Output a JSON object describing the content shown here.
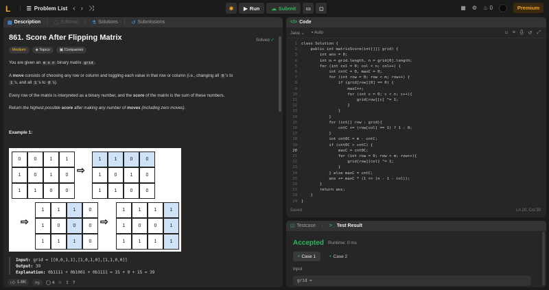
{
  "topbar": {
    "logo": "L",
    "problem_list": "Problem List",
    "run": "Run",
    "submit": "Submit",
    "streak_count": "0",
    "premium": "Premium"
  },
  "left_tabs": [
    {
      "label": "Description"
    },
    {
      "label": "Editorial"
    },
    {
      "label": "Solutions"
    },
    {
      "label": "Submissions"
    }
  ],
  "problem": {
    "title": "861. Score After Flipping Matrix",
    "solved": "Solved",
    "difficulty": "Medium",
    "topics": "Topics",
    "companies": "Companies",
    "p1_a": "You are given an ",
    "p1_code": "m x n",
    "p1_b": " binary matrix ",
    "p1_code2": "grid",
    "p1_c": ".",
    "p2_bold": "move",
    "p2_a": "A ",
    "p2_b": " consists of choosing any row or column and toggling each value in that row or column (i.e., changing all ",
    "p2_c0": "0",
    "p2_c": "'s to",
    "p2_c1": "1",
    "p2_d": "'s, and all ",
    "p2_c2": "1",
    "p2_e": "'s to ",
    "p2_c3": "0",
    "p2_f": "'s).",
    "p3_a": "Every row of the matrix is interpreted as a binary number, and the ",
    "p3_bold": "score",
    "p3_b": " of the matrix is the sum of these numbers.",
    "p4_a": "Return ",
    "p4_i1": "the highest possible ",
    "p4_bold": "score",
    "p4_i2": " after making any number of ",
    "p4_bold2": "moves",
    "p4_i3": " (including zero moves)",
    "p4_end": ".",
    "example_title": "Example 1:",
    "input_label": "Input:",
    "input_value": "grid = [[0,0,1,1],[1,0,1,0],[1,1,0,0]]",
    "output_label": "Output:",
    "output_value": "39",
    "explanation_label": "Explanation:",
    "explanation_value": "0b1111 + 0b1001 + 0b1111 = 15 + 9 + 15 = 39"
  },
  "figure": {
    "g1": [
      "0",
      "0",
      "1",
      "1",
      "1",
      "0",
      "1",
      "0",
      "1",
      "1",
      "0",
      "0"
    ],
    "g2": [
      "1",
      "1",
      "0",
      "0",
      "1",
      "0",
      "1",
      "0",
      "1",
      "1",
      "0",
      "0"
    ],
    "g3": [
      "1",
      "1",
      "1",
      "0",
      "1",
      "0",
      "0",
      "0",
      "1",
      "1",
      "1",
      "0"
    ],
    "g4": [
      "1",
      "1",
      "1",
      "1",
      "1",
      "0",
      "0",
      "1",
      "1",
      "1",
      "1",
      "1"
    ]
  },
  "footer": {
    "likes": "1.6K",
    "comments": "4"
  },
  "code_panel": {
    "tab": "Code",
    "language": "Java",
    "autosave": "Auto",
    "saved": "Saved",
    "cursor": "Ln 20, Col 30",
    "lines": [
      "class Solution {",
      "    public int matrixScore(int[][] grid) {",
      "        int ans = 0;",
      "        int m = grid.length, n = grid[0].length;",
      "        for (int col = 0; col < n; col++) {",
      "            int cntC = 0, maxC = 0;",
      "            for (int row = 0; row < m; row++) {",
      "                if (grid[row][0] == 0) {",
      "                    maxC++;",
      "                    for (int c = 0; c < n; c++){",
      "                        grid[row][c] ^= 1;",
      "                    }",
      "                }",
      "            }",
      "            for (int[] row : grid){",
      "                cntC += (row[col] == 1) ? 1 : 0;",
      "            }",
      "            int cnt0C = m - cntC;",
      "            if (cnt0C > cntC) {",
      "                maxC = cnt0C;",
      "                for (int row = 0; row < m; row++){",
      "                    grid[row][col] ^= 1;",
      "                }",
      "            } else maxC = cntC;",
      "            ans += maxC * (1 << (n - 1 - col));",
      "        }",
      "        return ans;",
      "    }",
      "}"
    ]
  },
  "result_panel": {
    "tab_testcase": "Testcase",
    "tab_result": "Test Result",
    "status": "Accepted",
    "runtime": "Runtime: 0 ms",
    "case1": "Case 1",
    "case2": "Case 2",
    "input_label": "Input",
    "input_value": "grid ="
  }
}
